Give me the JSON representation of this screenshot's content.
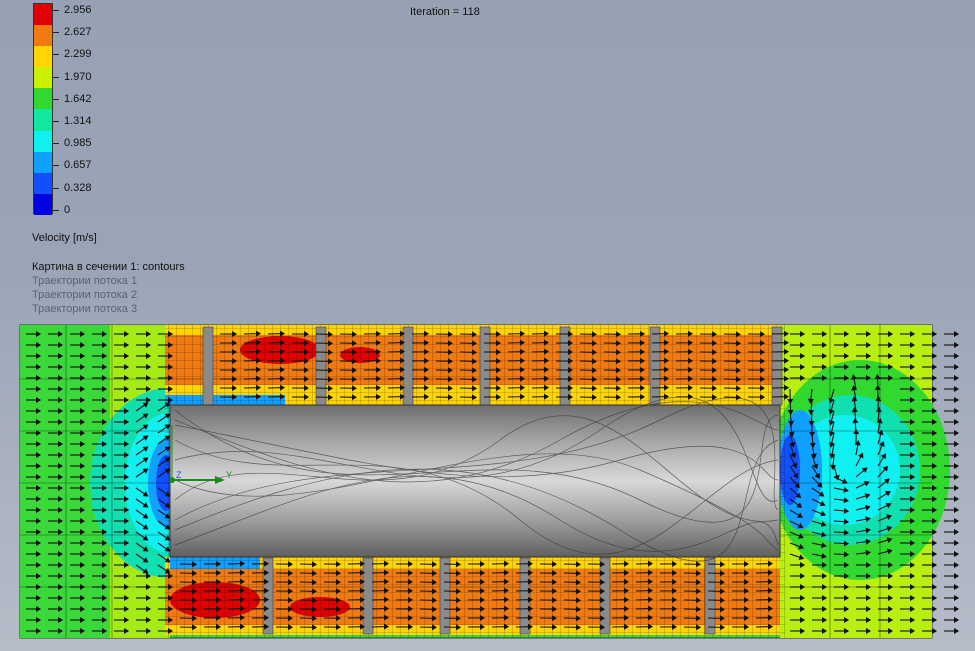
{
  "iteration_text": "Iteration = 118",
  "legend": {
    "title": "Velocity [m/s]",
    "ticks": [
      "2.956",
      "2.627",
      "2.299",
      "1.970",
      "1.642",
      "1.314",
      "0.985",
      "0.657",
      "0.328",
      "0"
    ],
    "colors": [
      "#e00000",
      "#f07a10",
      "#ffd400",
      "#c8f000",
      "#30d830",
      "#10e8a0",
      "#10f0f0",
      "#10a0ff",
      "#1050ff",
      "#0000e0"
    ]
  },
  "plots": {
    "section": "Картина в сечении 1: contours",
    "trajectories": [
      "Траектории потока 1",
      "Траектории потока 2",
      "Траектории потока 3"
    ]
  },
  "axis_labels": {
    "y": "Y",
    "z": "Z"
  }
}
